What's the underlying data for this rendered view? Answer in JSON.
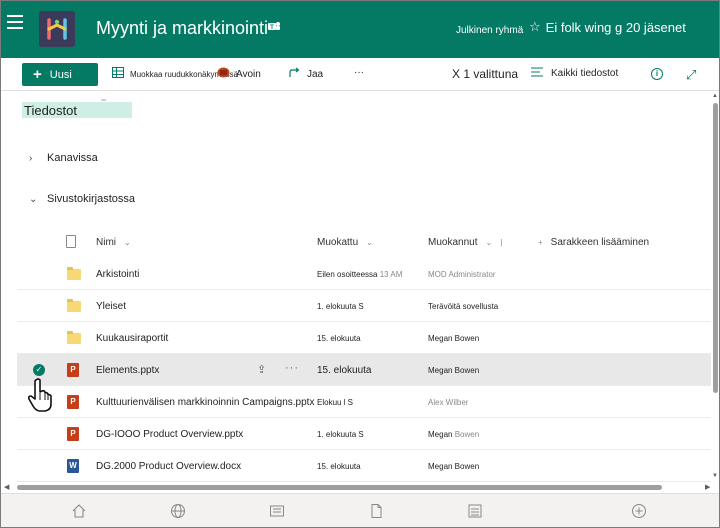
{
  "header": {
    "site_title": "Myynti ja markkinointi",
    "group_type": "Julkinen ryhmä",
    "follow_label": "Ei folk wing g 20 jäsenet"
  },
  "commandbar": {
    "new_label": "Uusi",
    "edit_grid_label": "Muokkaa ruudukkonäkymässä",
    "open_label": "Avoin",
    "share_label": "Jaa",
    "more_label": "···",
    "selected_label": "X 1 valittuna",
    "all_files_label": "Kaikki tiedostot"
  },
  "page": {
    "title": "Tiedostot",
    "title_tag": "ˢˢˢ"
  },
  "sections": {
    "channels": "Kanavissa",
    "site_library": "Sivustokirjastossa"
  },
  "columns": {
    "name": "Nimi",
    "modified": "Muokattu",
    "modified_by": "Muokannut",
    "add_column": "Sarakkeen lisääminen"
  },
  "rows": [
    {
      "name": "Arkistointi",
      "modified": "Eilen osoitteessa",
      "modified_muted": "13 AM",
      "modified_by": "MOD Administrator",
      "by_muted": true,
      "type": "folder"
    },
    {
      "name": "Yleiset",
      "modified": "1. elokuuta S",
      "modified_muted": "",
      "modified_by": "Terävöitä sovellusta",
      "by_muted": false,
      "type": "folder"
    },
    {
      "name": "Kuukausiraportit",
      "modified": "15. elokuuta",
      "modified_muted": "",
      "modified_by": "Megan Bowen",
      "by_muted": false,
      "type": "folder"
    },
    {
      "name": "Elements.pptx",
      "modified": "15. elokuuta",
      "modified_muted": "",
      "modified_by": "Megan Bowen",
      "by_muted": false,
      "type": "pptx",
      "selected": true
    },
    {
      "name": "Kulttuurienvälisen markkinoinnin Campaigns.pptx",
      "modified": "Elokuu l S",
      "modified_muted": "",
      "modified_by": "Alex Wilber",
      "by_muted": true,
      "type": "pptx"
    },
    {
      "name": "DG-IOOO Product Overview.pptx",
      "modified": "1. elokuuta S",
      "modified_muted": "",
      "modified_by": "Megan",
      "modified_by_muted": "Bowen",
      "by_muted": false,
      "type": "pptx"
    },
    {
      "name": "DG.2000 Product Overview.docx",
      "modified": "15. elokuuta",
      "modified_muted": "",
      "modified_by": "Megan Bowen",
      "by_muted": false,
      "type": "docx"
    }
  ],
  "icons": {
    "ppt_letter": "P",
    "doc_letter": "W"
  },
  "colors": {
    "brand": "#047a64",
    "folder": "#f8d775",
    "powerpoint": "#c43e1c",
    "word": "#2b579a",
    "selected_row": "#e8e8e8"
  }
}
